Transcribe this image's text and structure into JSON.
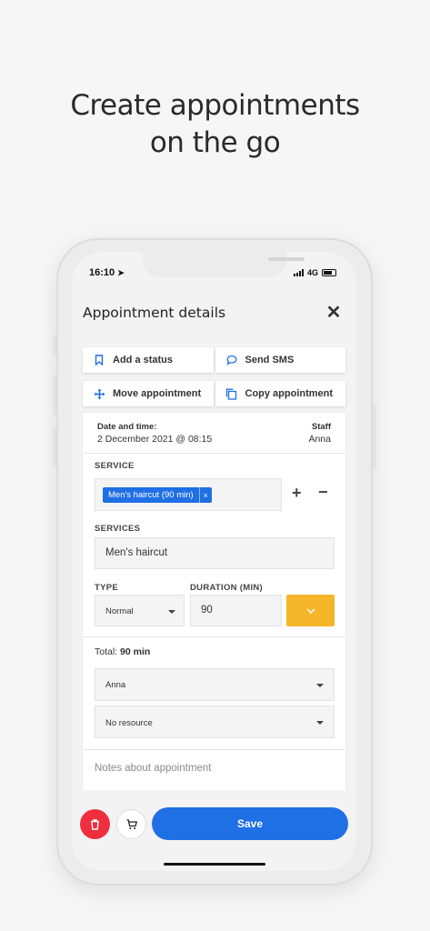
{
  "headline": {
    "line1": "Create appointments",
    "line2": "on the go"
  },
  "status_bar": {
    "time": "16:10",
    "network": "4G"
  },
  "header": {
    "title": "Appointment details"
  },
  "actions": {
    "add_status": "Add a status",
    "send_sms": "Send SMS",
    "move_appointment": "Move appointment",
    "copy_appointment": "Copy appointment"
  },
  "details": {
    "date_label": "Date and time:",
    "date_value": "2 December 2021 @ 08:15",
    "staff_label": "Staff",
    "staff_value": "Anna"
  },
  "service": {
    "label": "SERVICE",
    "chip": "Men's haircut (90 min)",
    "chip_remove": "×",
    "plus": "+",
    "minus": "−"
  },
  "services": {
    "label": "SERVICES",
    "value": "Men's haircut"
  },
  "type": {
    "label": "TYPE",
    "value": "Normal"
  },
  "duration": {
    "label": "DURATION (MIN)",
    "value": "90"
  },
  "total": {
    "prefix": "Total:",
    "value": "90 min"
  },
  "staff_select": {
    "value": "Anna"
  },
  "resource_select": {
    "value": "No resource"
  },
  "notes": {
    "placeholder": "Notes about appointment"
  },
  "footer": {
    "save": "Save"
  },
  "colors": {
    "primary": "#1f6fe5",
    "accent": "#f5b62a",
    "danger": "#ef2f3d"
  }
}
